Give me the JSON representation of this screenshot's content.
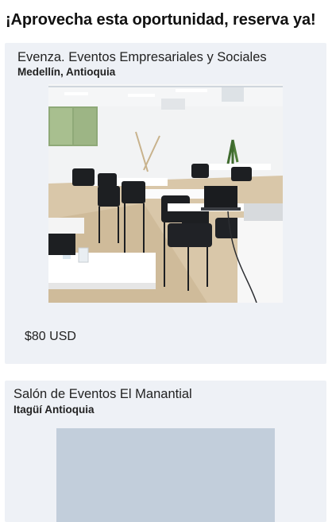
{
  "headline": "¡Aprovecha esta oportunidad, reserva ya!",
  "venues": [
    {
      "name": "Evenza. Eventos Empresariales y Sociales",
      "location": "Medellín, Antioquia",
      "price": "$80 USD",
      "image_icon": "conference-room-photo"
    },
    {
      "name": "Salón de Eventos El Manantial",
      "location": "Itagüí Antioquia",
      "image_icon": "image-placeholder"
    }
  ],
  "colors": {
    "card_background": "#eef1f6",
    "image_placeholder": "#c2cedb"
  }
}
